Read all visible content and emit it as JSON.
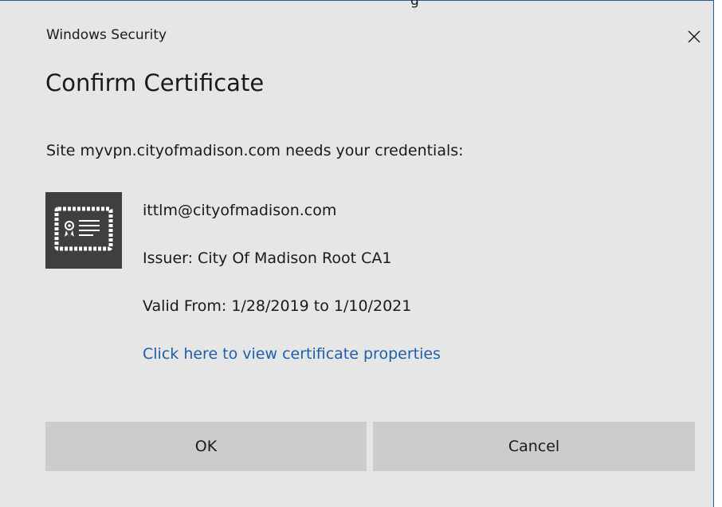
{
  "overflow_text": "g",
  "window": {
    "title": "Windows Security",
    "close_glyph": "✕"
  },
  "dialog": {
    "heading": "Confirm Certificate",
    "prompt": "Site myvpn.cityofmadison.com needs your credentials:",
    "certificate": {
      "icon": "certificate-icon",
      "subject": "ittlm@cityofmadison.com",
      "issuer": "Issuer: City Of Madison Root CA1",
      "validity": "Valid From: 1/28/2019 to 1/10/2021",
      "properties_link": "Click here to view certificate properties"
    }
  },
  "buttons": {
    "ok": "OK",
    "cancel": "Cancel"
  },
  "colors": {
    "dialog_bg": "#e6e6e6",
    "button_bg": "#cccccc",
    "link": "#1e5fa8",
    "icon_bg": "#3f3f3f",
    "border_accent": "#2b579a"
  }
}
